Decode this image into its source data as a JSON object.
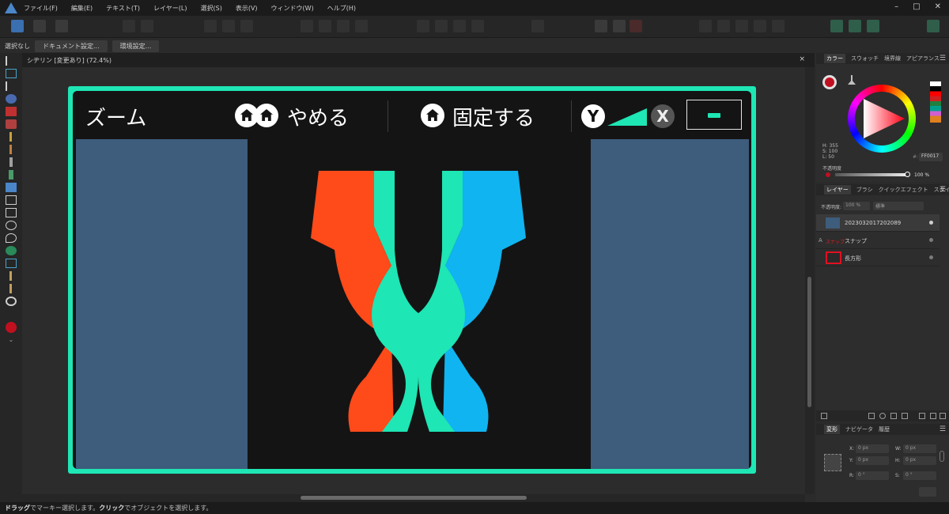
{
  "menu": {
    "items": [
      "ファイル(F)",
      "編集(E)",
      "テキスト(T)",
      "レイヤー(L)",
      "選択(S)",
      "表示(V)",
      "ウィンドウ(W)",
      "ヘルプ(H)"
    ],
    "min": "–",
    "max": "□",
    "close": "✕"
  },
  "context": {
    "selection": "選択なし",
    "doc_settings": "ドキュメント設定...",
    "env_settings": "環境設定..."
  },
  "document": {
    "tab_title": "シヂリン [変更あり] (72.4%)",
    "close": "×"
  },
  "artwork": {
    "zoom_label": "ズーム",
    "cancel_label": "やめる",
    "pin_label": "固定する",
    "y_button": "Y",
    "x_button": "X",
    "accent_color": "#1ee6b4",
    "panel_color": "#3e5c7c"
  },
  "color_panel": {
    "tabs": [
      "カラー",
      "スウォッチ",
      "境界線",
      "アピアランス"
    ],
    "h": "H: 355",
    "s": "S: 100",
    "l": "L: 50",
    "hex": "FF0017",
    "opacity_label": "不透明度",
    "opacity_value": "100 %"
  },
  "layers_panel": {
    "tabs": [
      "レイヤー",
      "ブラシ",
      "クイックエフェクト",
      "スタイル"
    ],
    "opacity_label": "不透明度:",
    "opacity_value": "100 %",
    "blend_mode": "標準",
    "layers": [
      {
        "name": "20230320172020​89",
        "type": "image"
      },
      {
        "name": "スナップ",
        "thumb_text": "スナップ",
        "type": "text"
      },
      {
        "name": "長方形",
        "type": "shape"
      }
    ]
  },
  "transform_panel": {
    "tabs": [
      "変形",
      "ナビゲータ",
      "履歴"
    ],
    "x": "X:",
    "x_val": "0 px",
    "y": "Y:",
    "y_val": "0 px",
    "w": "W:",
    "w_val": "0 px",
    "h": "H:",
    "h_val": "0 px",
    "r": "R:",
    "r_val": "0 °",
    "sh": "S:",
    "sh_val": "0 °"
  },
  "status": {
    "drag": "ドラッグ",
    "drag_text": "でマーキー選択します。",
    "click": "クリック",
    "click_text": "でオブジェクトを選択します。"
  }
}
